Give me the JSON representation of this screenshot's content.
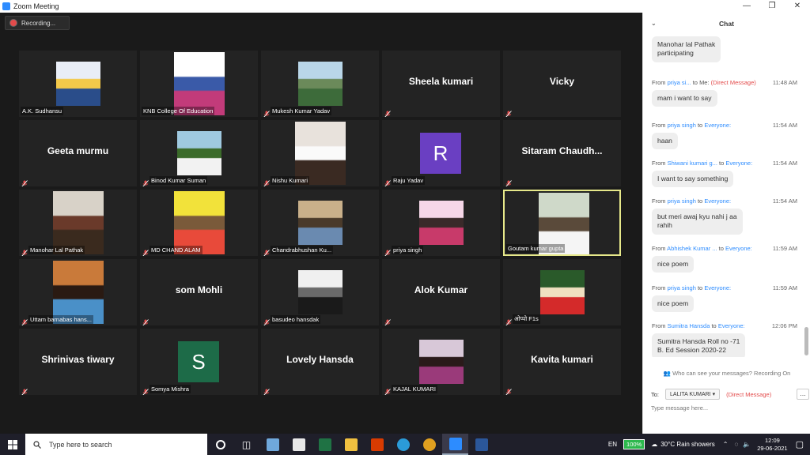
{
  "window": {
    "title": "Zoom Meeting"
  },
  "recording": {
    "label": "Recording..."
  },
  "participants": [
    {
      "name": "A.K. Sudhansu",
      "type": "video",
      "muted": false,
      "colors": [
        "#e9eef7",
        "#2a4d8a",
        "#f3c94a"
      ]
    },
    {
      "name": "KNB College Of Education",
      "type": "video",
      "muted": false,
      "colors": [
        "#ffffff",
        "#c23b7a",
        "#3a5aa8"
      ]
    },
    {
      "name": "Mukesh Kumar Yadav",
      "type": "video",
      "muted": true,
      "colors": [
        "#b9d6e8",
        "#3d6b3a",
        "#6b8a5a"
      ]
    },
    {
      "name": "Sheela kumari",
      "type": "name",
      "muted": true
    },
    {
      "name": "Vicky",
      "type": "name",
      "muted": true
    },
    {
      "name": "Geeta murmu",
      "type": "name",
      "muted": true
    },
    {
      "name": "Binod Kumar Suman",
      "type": "video",
      "muted": true,
      "colors": [
        "#9fc9e0",
        "#f2f2f2",
        "#3b6b2a"
      ]
    },
    {
      "name": "Nishu Kumari",
      "type": "video",
      "muted": true,
      "colors": [
        "#e8e2dc",
        "#3a2a22",
        "#fafafa"
      ]
    },
    {
      "name": "Raju Yadav",
      "type": "avatar",
      "initial": "R",
      "muted": true
    },
    {
      "name": "Sitaram  Chaudh...",
      "type": "name",
      "muted": true
    },
    {
      "name": "Manohar Lal Pathak",
      "type": "video",
      "muted": true,
      "colors": [
        "#d8d2c8",
        "#3a2a1e",
        "#6a3a2a"
      ]
    },
    {
      "name": "MD CHAND ALAM",
      "type": "video",
      "muted": true,
      "colors": [
        "#f2e23a",
        "#e84a3a",
        "#7a5a3a"
      ]
    },
    {
      "name": "Chandrabhushan Ku...",
      "type": "video",
      "muted": true,
      "colors": [
        "#c9b08a",
        "#6a8ab0",
        "#4a3a2a"
      ]
    },
    {
      "name": "priya singh",
      "type": "video",
      "muted": true,
      "colors": [
        "#f6d7e8",
        "#c83a6a",
        "#3a2a2a"
      ]
    },
    {
      "name": "Goutam kumar gupta",
      "type": "video",
      "muted": false,
      "active": true,
      "colors": [
        "#cfd9c9",
        "#f5f5f5",
        "#5a4a3a"
      ]
    },
    {
      "name": "Uttam barnabas hans...",
      "type": "video",
      "muted": true,
      "colors": [
        "#c97a3a",
        "#4a90c8",
        "#2a1a12"
      ]
    },
    {
      "name": "som Mohli",
      "type": "name",
      "muted": true
    },
    {
      "name": "basudeo hansdak",
      "type": "video",
      "muted": true,
      "colors": [
        "#f0f0f0",
        "#1a1a1a",
        "#6a6a6a"
      ]
    },
    {
      "name": "Alok Kumar",
      "type": "name",
      "muted": true
    },
    {
      "name": "ओप्पो F1s",
      "type": "video",
      "muted": true,
      "colors": [
        "#2a5a2a",
        "#d42a2a",
        "#f0e0c0"
      ]
    },
    {
      "name": "Shrinivas tiwary",
      "type": "name",
      "muted": true
    },
    {
      "name": "Somya Mishra",
      "type": "avatar",
      "initial": "S",
      "muted": true
    },
    {
      "name": "Lovely Hansda",
      "type": "name",
      "muted": true
    },
    {
      "name": "KAJAL KUMARI",
      "type": "video",
      "muted": true,
      "colors": [
        "#d8c8d8",
        "#9a3a7a",
        "#2a1a1a"
      ]
    },
    {
      "name": "Kavita kumari",
      "type": "name",
      "muted": true
    }
  ],
  "chat": {
    "title": "Chat",
    "messages": [
      {
        "from": "",
        "to": "",
        "dm": "",
        "time": "",
        "text": "Manohar lal Pathak\nparticipating"
      },
      {
        "from": "priya si...",
        "to": "Me:",
        "dm": "(Direct Message)",
        "time": "11:48 AM",
        "text": "mam i want to say"
      },
      {
        "from": "priya singh",
        "to": "Everyone:",
        "dm": "",
        "time": "11:54 AM",
        "text": "haan"
      },
      {
        "from": "Shiwani kumari g...",
        "to": "Everyone:",
        "dm": "",
        "time": "11:54 AM",
        "text": "I want to say something"
      },
      {
        "from": "priya singh",
        "to": "Everyone:",
        "dm": "",
        "time": "11:54 AM",
        "text": "but meri awaj kyu nahi j aa\nrahih"
      },
      {
        "from": "Abhishek Kumar ...",
        "to": "Everyone:",
        "dm": "",
        "time": "11:59 AM",
        "text": "nice poem"
      },
      {
        "from": "priya singh",
        "to": "Everyone:",
        "dm": "",
        "time": "11:59 AM",
        "text": "nice poem"
      },
      {
        "from": "Sumitra Hansda",
        "to": "Everyone:",
        "dm": "",
        "time": "12:06 PM",
        "text": "Sumitra Hansda Roll no -71\nB. Ed Session 2020-22"
      }
    ],
    "from_word": "From",
    "to_word": "to",
    "privacy_note": "Who can see your messages? Recording On",
    "to_label": "To:",
    "recipient": "LALITA KUMARI",
    "recipient_dm": "(Direct Message)",
    "more_label": "...",
    "input_placeholder": "Type message here..."
  },
  "taskbar": {
    "search_placeholder": "Type here to search",
    "lang": "EN",
    "battery": "100%",
    "weather": "30°C  Rain showers",
    "time": "12:09",
    "date": "29-06-2021"
  }
}
